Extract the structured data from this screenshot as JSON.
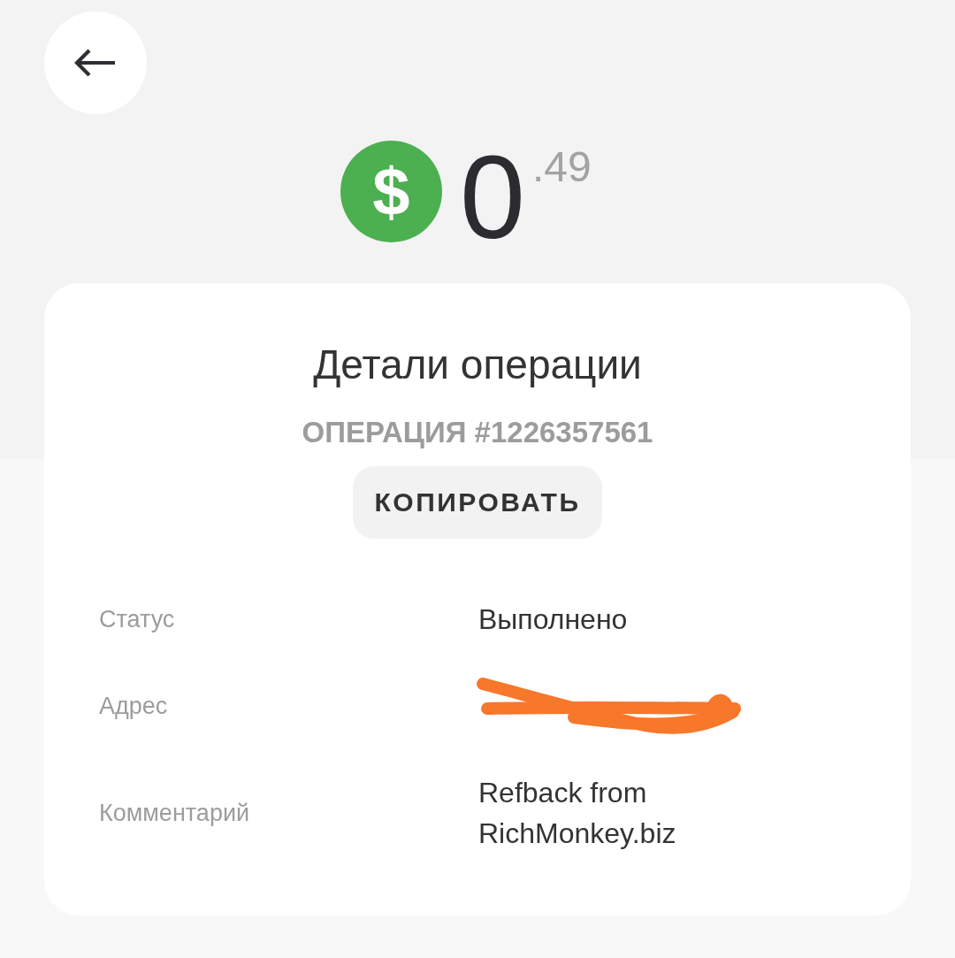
{
  "balance": {
    "currency_symbol": "$",
    "whole": "0",
    "fraction": ".49"
  },
  "details": {
    "title": "Детали операции",
    "operation_number": "ОПЕРАЦИЯ #1226357561",
    "copy_button": {
      "label": "КОПИРОВАТЬ"
    },
    "rows": [
      {
        "label": "Статус",
        "kind": "text",
        "value": "Выполнено"
      },
      {
        "label": "Адрес",
        "kind": "redacted"
      },
      {
        "label": "Комментарий",
        "kind": "text",
        "value": "Refback from RichMonkey.biz"
      }
    ]
  }
}
